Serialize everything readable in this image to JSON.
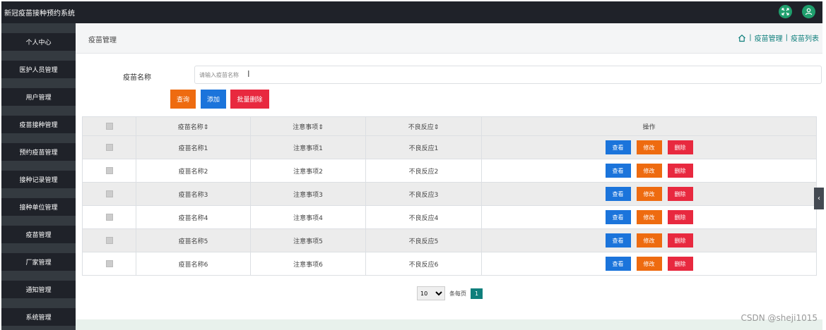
{
  "app": {
    "title": "新冠疫苗接种预约系统"
  },
  "sidebar": {
    "items": [
      {
        "label": "个人中心"
      },
      {
        "label": "医护人员管理"
      },
      {
        "label": "用户管理"
      },
      {
        "label": "疫苗接种管理"
      },
      {
        "label": "预约疫苗管理"
      },
      {
        "label": "接种记录管理"
      },
      {
        "label": "接种单位管理"
      },
      {
        "label": "疫苗管理"
      },
      {
        "label": "厂家管理"
      },
      {
        "label": "通知管理"
      },
      {
        "label": "系统管理"
      }
    ]
  },
  "header": {
    "page_title": "疫苗管理",
    "breadcrumb": [
      "疫苗管理",
      "疫苗列表"
    ]
  },
  "search": {
    "label": "疫苗名称",
    "placeholder": "请输入疫苗名称",
    "query_label": "查询",
    "add_label": "添加",
    "bulk_delete_label": "批量删除"
  },
  "table": {
    "headers": [
      "疫苗名称⇕",
      "注意事项⇕",
      "不良反应⇕",
      "操作"
    ],
    "rows": [
      [
        "疫苗名称1",
        "注意事项1",
        "不良反应1"
      ],
      [
        "疫苗名称2",
        "注意事项2",
        "不良反应2"
      ],
      [
        "疫苗名称3",
        "注意事项3",
        "不良反应3"
      ],
      [
        "疫苗名称4",
        "注意事项4",
        "不良反应4"
      ],
      [
        "疫苗名称5",
        "注意事项5",
        "不良反应5"
      ],
      [
        "疫苗名称6",
        "注意事项6",
        "不良反应6"
      ]
    ],
    "actions": {
      "view": "查看",
      "edit": "修改",
      "delete": "删除"
    }
  },
  "pagination": {
    "page_size": "10",
    "per_page_label": "条每页",
    "current_page": "1"
  },
  "watermark": "CSDN @sheji1015",
  "colors": {
    "topbar": "#1f2229",
    "sidebar_item": "#1f2229",
    "accent_teal": "#0f7f7c",
    "primary_blue": "#1b74db",
    "warning_orange": "#ee6b10",
    "danger_red": "#e8293f"
  },
  "icons": {
    "top_right": [
      "fullscreen-icon",
      "user-icon"
    ],
    "breadcrumb_home": "home-icon",
    "collapse": "chevron-left-icon"
  }
}
